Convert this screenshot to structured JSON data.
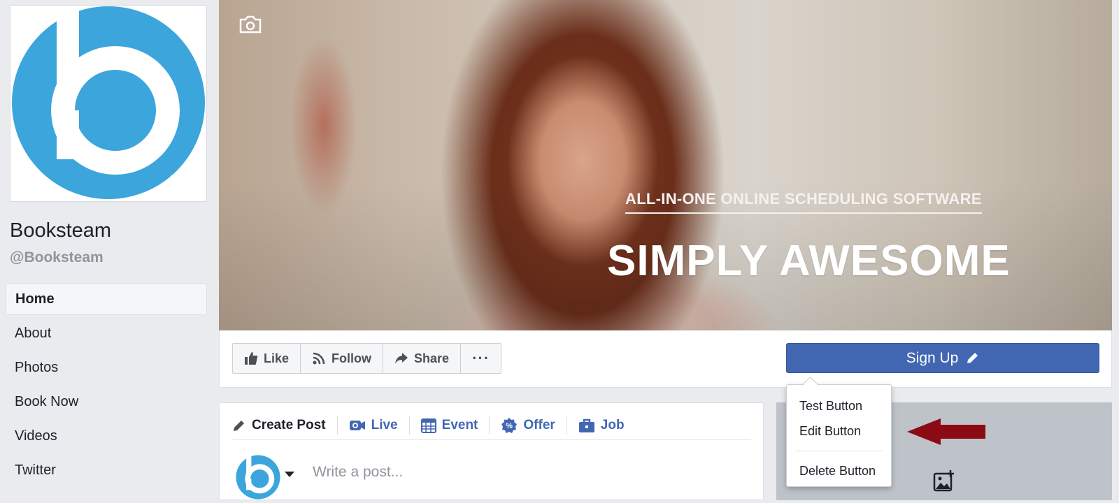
{
  "page": {
    "name": "Booksteam",
    "handle": "@Booksteam",
    "brand_color": "#3ca5dc"
  },
  "sidebar": {
    "items": [
      {
        "label": "Home",
        "active": true
      },
      {
        "label": "About"
      },
      {
        "label": "Photos"
      },
      {
        "label": "Book Now"
      },
      {
        "label": "Videos"
      },
      {
        "label": "Twitter"
      }
    ]
  },
  "cover": {
    "tagline": "ALL-IN-ONE ONLINE SCHEDULING SOFTWARE",
    "headline": "SIMPLY AWESOME",
    "camera_icon": "camera-icon"
  },
  "actions": {
    "like": "Like",
    "follow": "Follow",
    "share": "Share",
    "more": "···",
    "cta_label": "Sign Up",
    "cta_color": "#4267b2"
  },
  "dropdown": {
    "items": [
      "Test Button",
      "Edit Button",
      "Delete Button"
    ]
  },
  "composer": {
    "tabs": [
      "Create Post",
      "Live",
      "Event",
      "Offer",
      "Job"
    ],
    "placeholder": "Write a post..."
  },
  "annotation": {
    "arrow_color": "#8b0a14"
  }
}
